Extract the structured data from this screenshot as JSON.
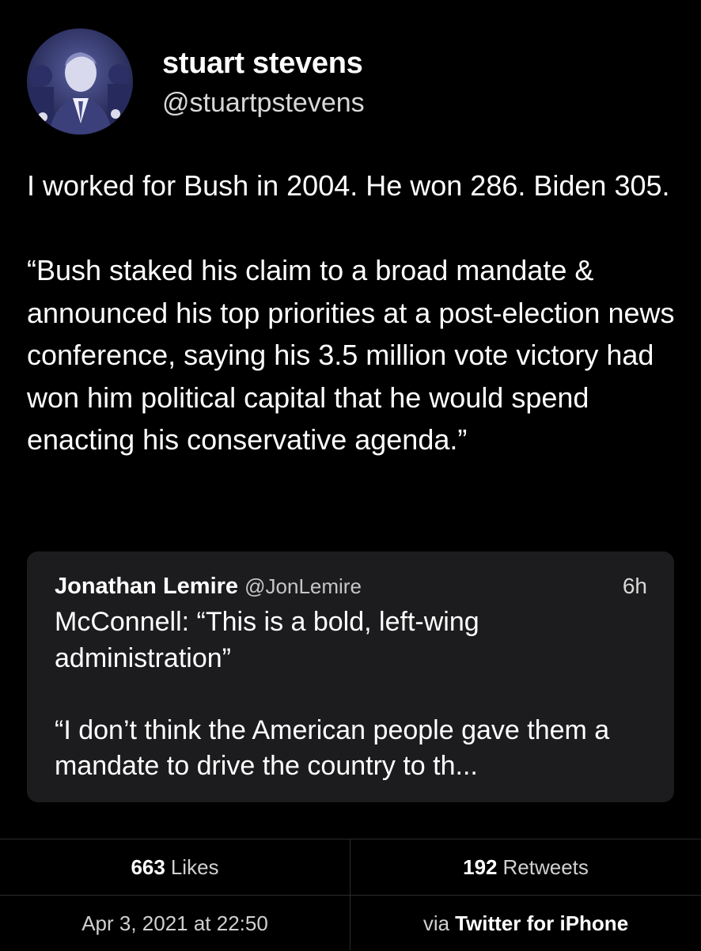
{
  "author": {
    "display_name": "stuart stevens",
    "handle": "@stuartpstevens",
    "avatar_icon": "profile-photo"
  },
  "tweet": {
    "paragraphs": [
      "I worked for Bush in 2004. He won 286. Biden 305.",
      "“Bush staked his claim to a broad mandate & announced his top priorities at a post-election news conference, saying his 3.5 million vote victory had won him political capital that he would spend enacting his conservative agenda.”"
    ]
  },
  "quoted_tweet": {
    "name": "Jonathan Lemire",
    "handle": "@JonLemire",
    "time": "6h",
    "paragraphs": [
      "McConnell: “This is a bold, left-wing administration”",
      "“I don’t think the American people gave them a mandate to drive the country to th..."
    ]
  },
  "stats": {
    "likes_count": "663",
    "likes_label": "Likes",
    "retweets_count": "192",
    "retweets_label": "Retweets",
    "timestamp": "Apr 3, 2021 at 22:50",
    "via_prefix": "via",
    "source": "Twitter for iPhone"
  },
  "colors": {
    "background": "#000000",
    "card": "#1c1c1e",
    "divider": "#2a2a2c"
  }
}
